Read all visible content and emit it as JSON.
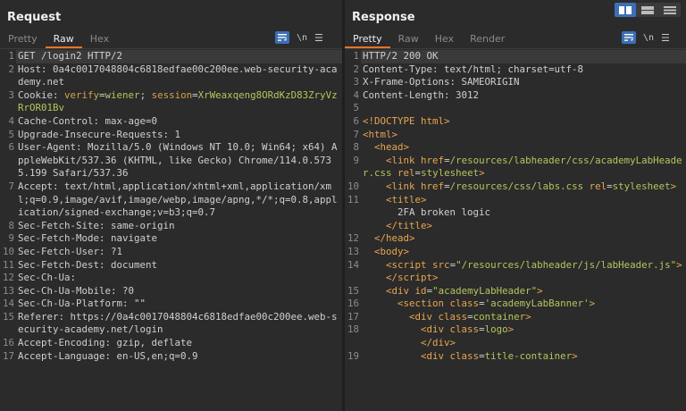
{
  "request": {
    "title": "Request",
    "tabs": [
      {
        "label": "Pretty",
        "active": false
      },
      {
        "label": "Raw",
        "active": true
      },
      {
        "label": "Hex",
        "active": false
      }
    ],
    "tool_newline": "\\n",
    "tool_menu": "☰",
    "lines": [
      {
        "n": "1",
        "k": "GET /login2 HTTP/2",
        "v": "",
        "style": "plain"
      },
      {
        "n": "2",
        "k": "Host",
        "v": "0a4c0017048804c6818edfae00c200ee.web-security-academy.net",
        "style": "header"
      },
      {
        "n": "3",
        "k": "Cookie",
        "v": "",
        "style": "cookie",
        "cookie_a": "verify",
        "cookie_a_val": "wiener",
        "cookie_b": "session",
        "cookie_b_val": "XrWeaxqeng8ORdKzD83ZryVzRrOR01Bv"
      },
      {
        "n": "4",
        "k": "Cache-Control",
        "v": "max-age=0",
        "style": "header"
      },
      {
        "n": "5",
        "k": "Upgrade-Insecure-Requests",
        "v": "1",
        "style": "header"
      },
      {
        "n": "6",
        "k": "User-Agent",
        "v": "Mozilla/5.0 (Windows NT 10.0; Win64; x64) AppleWebKit/537.36 (KHTML, like Gecko) Chrome/114.0.5735.199 Safari/537.36",
        "style": "header"
      },
      {
        "n": "7",
        "k": "Accept",
        "v": "text/html,application/xhtml+xml,application/xml;q=0.9,image/avif,image/webp,image/apng,*/*;q=0.8,application/signed-exchange;v=b3;q=0.7",
        "style": "header"
      },
      {
        "n": "8",
        "k": "Sec-Fetch-Site",
        "v": "same-origin",
        "style": "header"
      },
      {
        "n": "9",
        "k": "Sec-Fetch-Mode",
        "v": "navigate",
        "style": "header"
      },
      {
        "n": "10",
        "k": "Sec-Fetch-User",
        "v": "?1",
        "style": "header"
      },
      {
        "n": "11",
        "k": "Sec-Fetch-Dest",
        "v": "document",
        "style": "header"
      },
      {
        "n": "12",
        "k": "Sec-Ch-Ua",
        "v": "",
        "style": "header"
      },
      {
        "n": "13",
        "k": "Sec-Ch-Ua-Mobile",
        "v": "?0",
        "style": "header"
      },
      {
        "n": "14",
        "k": "Sec-Ch-Ua-Platform",
        "v": "\"\"",
        "style": "header"
      },
      {
        "n": "15",
        "k": "Referer",
        "v": "https://0a4c0017048804c6818edfae00c200ee.web-security-academy.net/login",
        "style": "header"
      },
      {
        "n": "16",
        "k": "Accept-Encoding",
        "v": "gzip, deflate",
        "style": "header"
      },
      {
        "n": "17",
        "k": "Accept-Language",
        "v": "en-US,en;q=0.9",
        "style": "header"
      }
    ]
  },
  "response": {
    "title": "Response",
    "tabs": [
      {
        "label": "Pretty",
        "active": true
      },
      {
        "label": "Raw",
        "active": false
      },
      {
        "label": "Hex",
        "active": false
      },
      {
        "label": "Render",
        "active": false
      }
    ],
    "tool_newline": "\\n",
    "tool_menu": "☰",
    "lines": [
      {
        "n": "1",
        "html": "HTTP/2 200 OK"
      },
      {
        "n": "2",
        "html": "Content-Type: text/html; charset=utf-8"
      },
      {
        "n": "3",
        "html": "X-Frame-Options: SAMEORIGIN"
      },
      {
        "n": "4",
        "html": "Content-Length: 3012"
      },
      {
        "n": "5",
        "html": ""
      },
      {
        "n": "6",
        "html": "<t>&lt;!DOCTYPE html&gt;</t>"
      },
      {
        "n": "7",
        "html": "<t>&lt;html&gt;</t>"
      },
      {
        "n": "8",
        "html": "  <t>&lt;head&gt;</t>"
      },
      {
        "n": "9",
        "html": "    <t>&lt;link</t> <a>href</a>=<s>/resources/labheader/css/academyLabHeader.css</s> <a>rel</a>=<s>stylesheet</s><t>&gt;</t>"
      },
      {
        "n": "10",
        "html": "    <t>&lt;link</t> <a>href</a>=<s>/resources/css/labs.css</s> <a>rel</a>=<s>stylesheet</s><t>&gt;</t>"
      },
      {
        "n": "11",
        "html": "    <t>&lt;title&gt;</t>\n      2FA broken logic\n    <t>&lt;/title&gt;</t>"
      },
      {
        "n": "12",
        "html": "  <t>&lt;/head&gt;</t>"
      },
      {
        "n": "13",
        "html": "  <t>&lt;body&gt;</t>"
      },
      {
        "n": "14",
        "html": "    <t>&lt;script</t> <a>src</a>=<s>\"/resources/labheader/js/labHeader.js\"</s><t>&gt;</t>\n    <t>&lt;/script&gt;</t>"
      },
      {
        "n": "15",
        "html": "    <t>&lt;div</t> <a>id</a>=<s>\"academyLabHeader\"</s><t>&gt;</t>"
      },
      {
        "n": "16",
        "html": "      <t>&lt;section</t> <a>class</a>=<s>'academyLabBanner'</s><t>&gt;</t>"
      },
      {
        "n": "17",
        "html": "        <t>&lt;div</t> <a>class</a>=<s>container</s><t>&gt;</t>"
      },
      {
        "n": "18",
        "html": "          <t>&lt;div</t> <a>class</a>=<s>logo</s><t>&gt;</t>\n          <t>&lt;/div&gt;</t>"
      },
      {
        "n": "19",
        "html": "          <t>&lt;div</t> <a>class</a>=<s>title-container</s><t>&gt;</t>"
      }
    ]
  },
  "layout_toggle": {
    "selected": "side-by-side",
    "options": [
      "side-by-side",
      "horizontal",
      "vertical"
    ]
  },
  "colors": {
    "accent": "#e8722a",
    "tool_blue": "#3d6fb5",
    "string": "#b7c35e",
    "tag": "#e8a550"
  }
}
